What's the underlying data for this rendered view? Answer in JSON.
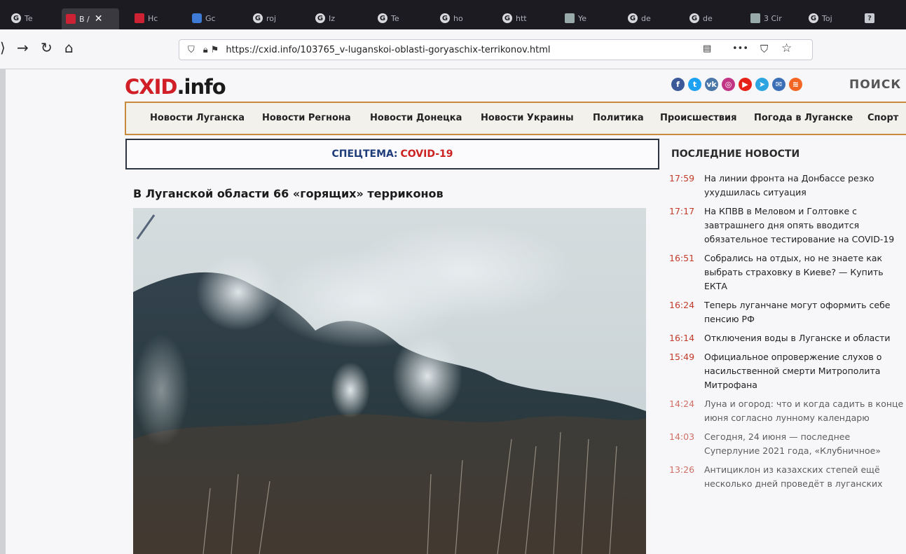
{
  "browser": {
    "tabs": [
      {
        "label": "Te",
        "icon": "g-icon"
      },
      {
        "label": "B / ",
        "icon": "red-square-icon",
        "active": true
      },
      {
        "label": "Hc",
        "icon": "red-square-icon"
      },
      {
        "label": "Gc",
        "icon": "blue-square-icon"
      },
      {
        "label": "roj",
        "icon": "g-icon"
      },
      {
        "label": "Iz",
        "icon": "g-icon"
      },
      {
        "label": "Te",
        "icon": "g-icon"
      },
      {
        "label": "ho",
        "icon": "g-icon"
      },
      {
        "label": "htt",
        "icon": "g-icon"
      },
      {
        "label": "Ye",
        "icon": "doc-icon"
      },
      {
        "label": "de",
        "icon": "g-icon"
      },
      {
        "label": "de",
        "icon": "g-icon"
      },
      {
        "label": "3 Cir",
        "icon": "doc-icon"
      },
      {
        "label": "Toj",
        "icon": "g-icon"
      }
    ],
    "url": "https://cxid.info/103765_v-luganskoi-oblasti-goryaschix-terrikonov.html"
  },
  "site": {
    "logo_part1": "CXID",
    "logo_part2": ".info",
    "search_label": "ПОИСК",
    "socials": [
      {
        "icon": "facebook-icon",
        "color": "#3b5998",
        "glyph": "f"
      },
      {
        "icon": "twitter-icon",
        "color": "#1da1f2",
        "glyph": "t"
      },
      {
        "icon": "vk-icon",
        "color": "#4a76a8",
        "glyph": "vk"
      },
      {
        "icon": "instagram-icon",
        "color": "#c13584",
        "glyph": "◎"
      },
      {
        "icon": "youtube-icon",
        "color": "#e62117",
        "glyph": "▶"
      },
      {
        "icon": "telegram-icon",
        "color": "#2ca5e0",
        "glyph": "➤"
      },
      {
        "icon": "email-icon",
        "color": "#3b6fb6",
        "glyph": "✉"
      },
      {
        "icon": "rss-icon",
        "color": "#f26522",
        "glyph": "≋"
      }
    ],
    "nav": [
      "Новости Луганска",
      "Новости Регнона",
      "Новости Донецка",
      "Новости Украины",
      "Политика",
      "Происшествия",
      "Погода в Луганске",
      "Спорт"
    ],
    "spectema_label": "СПЕЦТЕМА:",
    "spectema_value": "COVID-19",
    "headline": "В Луганской области 66 «горящих» терриконов",
    "latest_title": "ПОСЛЕДНИЕ НОВОСТИ",
    "news": [
      {
        "time": "17:59",
        "text": "На линии фронта на Донбассе резко\nухудшилась ситуация"
      },
      {
        "time": "17:17",
        "text": "На КПВВ в Меловом и Голтовке с\nзавтрашнего дня опять вводится\nобязательное тестирование на COVID-19"
      },
      {
        "time": "16:51",
        "text": "Собрались на отдых, но не знаете как\nвыбрать страховку в Киеве? — Купить\nЕКТА"
      },
      {
        "time": "16:24",
        "text": "Теперь луганчане могут оформить себе\nпенсию РФ"
      },
      {
        "time": "16:14",
        "text": "Отключения воды в Луганске и области"
      },
      {
        "time": "15:49",
        "text": "Официальное опровержение слухов о\nнасильственной смерти Митрополита\nМитрофана"
      },
      {
        "time": "14:24",
        "text": "Луна и огород: что и когда садить в конце\nиюня согласно лунному календарю"
      },
      {
        "time": "14:03",
        "text": "Сегодня, 24 июня — последнее\nСуперлуние 2021 года, «Клубничное»"
      },
      {
        "time": "13:26",
        "text": "Антициклон из казахских степей ещё\nнесколько дней проведёт в луганских"
      }
    ]
  }
}
